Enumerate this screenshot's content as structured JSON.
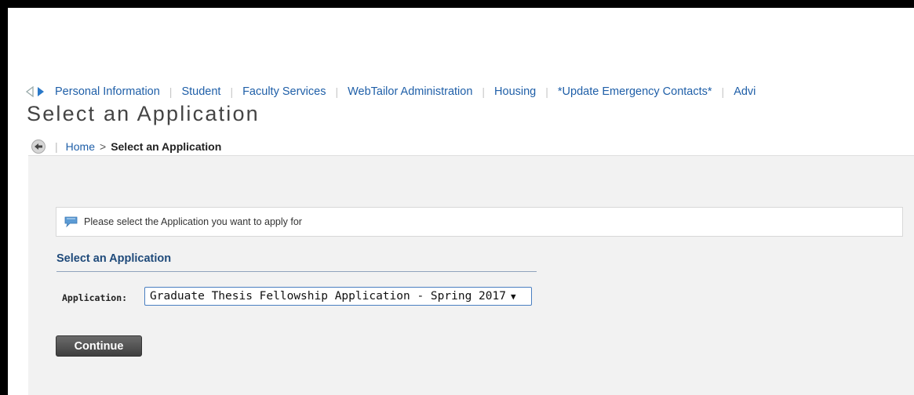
{
  "nav": {
    "items": [
      "Personal Information",
      "Student",
      "Faculty Services",
      "WebTailor Administration",
      "Housing",
      "*Update Emergency Contacts*",
      "Advi"
    ]
  },
  "page": {
    "title": "Select an Application"
  },
  "breadcrumb": {
    "home": "Home",
    "separator": ">",
    "current": "Select an Application"
  },
  "info": {
    "message": "Please select the Application you want to apply for"
  },
  "form": {
    "section_heading": "Select an Application",
    "application_label": "Application:",
    "application_selected": "Graduate Thesis Fellowship Application - Spring 2017",
    "caret": "▼",
    "continue_label": "Continue"
  },
  "colors": {
    "link": "#1f5fa8",
    "heading": "#1f4a7a",
    "panel_bg": "#f2f2f2",
    "button_bg": "#4f4f4f"
  }
}
